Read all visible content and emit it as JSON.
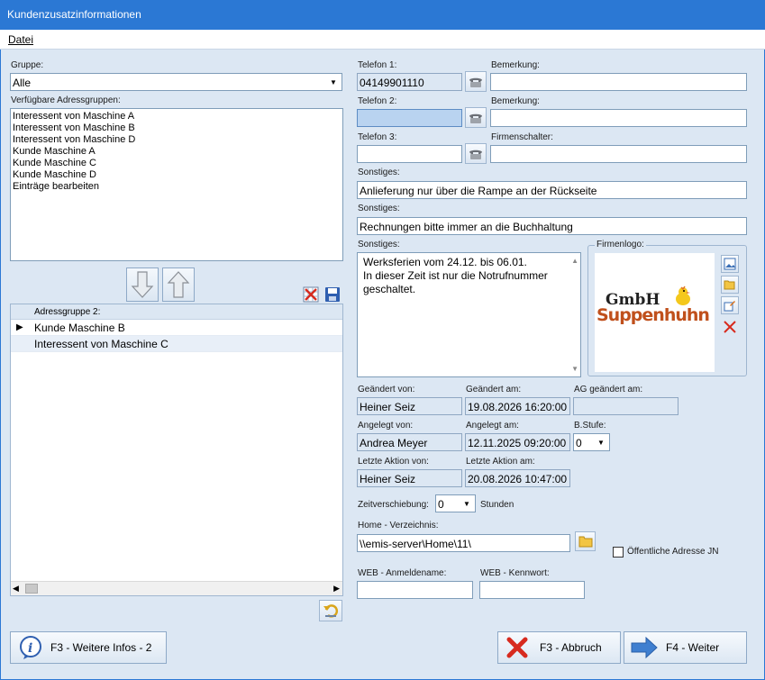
{
  "window": {
    "title": "Kundenzusatzinformationen"
  },
  "menu": {
    "datei": "Datei"
  },
  "left": {
    "gruppe_label": "Gruppe:",
    "gruppe_value": "Alle",
    "verfuegbar_label": "Verfügbare Adressgruppen:",
    "verfuegbar_items": [
      "Interessent von Maschine A",
      "Interessent von Maschine B",
      "Interessent von Maschine D",
      "Kunde Maschine A",
      "Kunde Maschine C",
      "Kunde Maschine D",
      "Einträge bearbeiten"
    ],
    "grid_header": "Adressgruppe 2:",
    "grid_rows": [
      "Kunde Maschine B",
      "Interessent von Maschine C"
    ]
  },
  "right": {
    "telefon1_label": "Telefon 1:",
    "telefon1_value": "04149901110",
    "bemerkung1_label": "Bemerkung:",
    "bemerkung1_value": "",
    "telefon2_label": "Telefon 2:",
    "telefon2_value": "",
    "bemerkung2_label": "Bemerkung:",
    "bemerkung2_value": "",
    "telefon3_label": "Telefon 3:",
    "telefon3_value": "",
    "firmenschalter_label": "Firmenschalter:",
    "firmenschalter_value": "",
    "sonstiges1_label": "Sonstiges:",
    "sonstiges1_value": "Anlieferung nur über die Rampe an der Rückseite",
    "sonstiges2_label": "Sonstiges:",
    "sonstiges2_value": "Rechnungen bitte immer an die Buchhaltung",
    "sonstiges3_label": "Sonstiges:",
    "sonstiges3_line1": "Werksferien vom 24.12. bis 06.01.",
    "sonstiges3_line2": "In dieser Zeit ist nur die Notrufnummer",
    "sonstiges3_line3": "geschaltet.",
    "firmenlogo_label": "Firmenlogo:",
    "logo_top": "GmbH",
    "logo_bottom": "Suppenhuhn",
    "geaendert_von_label": "Geändert von:",
    "geaendert_von_value": "Heiner Seiz",
    "geaendert_am_label": "Geändert am:",
    "geaendert_am_value": "19.08.2026 16:20:00",
    "ag_geaendert_label": "AG geändert am:",
    "ag_geaendert_value": "",
    "angelegt_von_label": "Angelegt von:",
    "angelegt_von_value": "Andrea Meyer",
    "angelegt_am_label": "Angelegt am:",
    "angelegt_am_value": "12.11.2025 09:20:00",
    "bstufe_label": "B.Stufe:",
    "bstufe_value": "0",
    "letzte_von_label": "Letzte Aktion von:",
    "letzte_von_value": "Heiner Seiz",
    "letzte_am_label": "Letzte Aktion am:",
    "letzte_am_value": "20.08.2026 10:47:00",
    "zeitverschiebung_label": "Zeitverschiebung:",
    "zeitverschiebung_value": "0",
    "stunden_label": "Stunden",
    "home_label": "Home - Verzeichnis:",
    "home_value": "\\\\emis-server\\Home\\11\\",
    "oeffentlich_label": "Öffentliche Adresse JN",
    "web_name_label": "WEB - Anmeldename:",
    "web_name_value": "",
    "web_pw_label": "WEB - Kennwort:",
    "web_pw_value": ""
  },
  "footer": {
    "info_label": "F3 - Weitere Infos - 2",
    "abbruch_label": "F3 - Abbruch",
    "weiter_label": "F4 - Weiter"
  }
}
